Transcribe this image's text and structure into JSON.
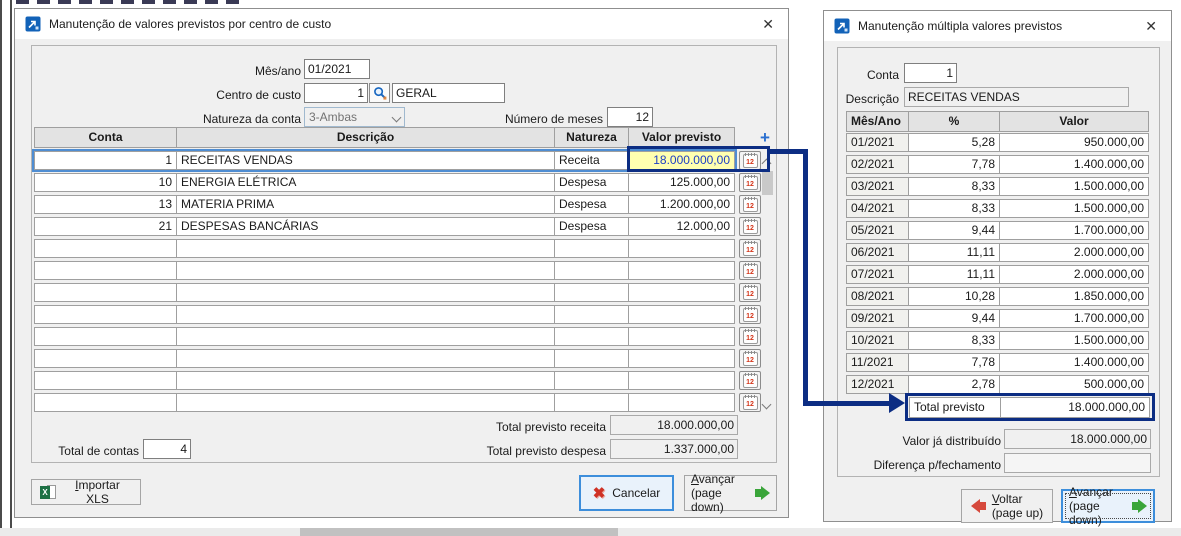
{
  "icons": {
    "close": "✕",
    "plus": "+",
    "cancel_x": "✖",
    "calendar_day": "12",
    "excel_letter": "X"
  },
  "colors": {
    "accent_navy": "#0c2d83",
    "selection_blue": "#4f8dd2",
    "highlight_yellow": "#ffffb0",
    "highlight_text_blue": "#1d3fc4",
    "focus_blue": "#3d8edb",
    "green_arrow": "#3aa53a",
    "red_arrow": "#d6493c",
    "cancel_red": "#cf3226",
    "excel_green": "#1e7145",
    "icon_blue": "#1565c0"
  },
  "left_window": {
    "title": "Manutenção de valores previstos por centro de custo",
    "form": {
      "mes_ano": {
        "label": "Mês/ano",
        "value": "01/2021"
      },
      "centro_custo": {
        "label": "Centro de custo",
        "code": "1",
        "name": "GERAL"
      },
      "natureza": {
        "label": "Natureza da conta",
        "value": "3-Ambas"
      },
      "numero_meses": {
        "label": "Número de meses",
        "value": "12"
      }
    },
    "table": {
      "headers": [
        "Conta",
        "Descrição",
        "Natureza",
        "Valor previsto"
      ],
      "selected_row": 0,
      "rows": [
        {
          "conta": "1",
          "descricao": "RECEITAS VENDAS",
          "natureza": "Receita",
          "valor": "18.000.000,00"
        },
        {
          "conta": "10",
          "descricao": "ENERGIA ELÉTRICA",
          "natureza": "Despesa",
          "valor": "125.000,00"
        },
        {
          "conta": "13",
          "descricao": "MATERIA PRIMA",
          "natureza": "Despesa",
          "valor": "1.200.000,00"
        },
        {
          "conta": "21",
          "descricao": "DESPESAS BANCÁRIAS",
          "natureza": "Despesa",
          "valor": "12.000,00"
        },
        {
          "conta": "",
          "descricao": "",
          "natureza": "",
          "valor": ""
        },
        {
          "conta": "",
          "descricao": "",
          "natureza": "",
          "valor": ""
        },
        {
          "conta": "",
          "descricao": "",
          "natureza": "",
          "valor": ""
        },
        {
          "conta": "",
          "descricao": "",
          "natureza": "",
          "valor": ""
        },
        {
          "conta": "",
          "descricao": "",
          "natureza": "",
          "valor": ""
        },
        {
          "conta": "",
          "descricao": "",
          "natureza": "",
          "valor": ""
        },
        {
          "conta": "",
          "descricao": "",
          "natureza": "",
          "valor": ""
        },
        {
          "conta": "",
          "descricao": "",
          "natureza": "",
          "valor": ""
        }
      ]
    },
    "totals": {
      "receita": {
        "label": "Total previsto receita",
        "value": "18.000.000,00"
      },
      "despesa": {
        "label": "Total previsto despesa",
        "value": "1.337.000,00"
      },
      "contas": {
        "label": "Total de contas",
        "value": "4"
      }
    },
    "buttons": {
      "importar": "Importar XLS",
      "cancelar": "Cancelar",
      "avancar": {
        "line1": "Avançar",
        "line2": "(page down)"
      }
    }
  },
  "right_window": {
    "title": "Manutenção múltipla valores previstos",
    "form": {
      "conta": {
        "label": "Conta",
        "value": "1"
      },
      "descricao": {
        "label": "Descrição",
        "value": "RECEITAS VENDAS"
      }
    },
    "table": {
      "headers": [
        "Mês/Ano",
        "%",
        "Valor"
      ],
      "rows": [
        {
          "mes": "01/2021",
          "pct": "5,28",
          "valor": "950.000,00"
        },
        {
          "mes": "02/2021",
          "pct": "7,78",
          "valor": "1.400.000,00"
        },
        {
          "mes": "03/2021",
          "pct": "8,33",
          "valor": "1.500.000,00"
        },
        {
          "mes": "04/2021",
          "pct": "8,33",
          "valor": "1.500.000,00"
        },
        {
          "mes": "05/2021",
          "pct": "9,44",
          "valor": "1.700.000,00"
        },
        {
          "mes": "06/2021",
          "pct": "11,11",
          "valor": "2.000.000,00"
        },
        {
          "mes": "07/2021",
          "pct": "11,11",
          "valor": "2.000.000,00"
        },
        {
          "mes": "08/2021",
          "pct": "10,28",
          "valor": "1.850.000,00"
        },
        {
          "mes": "09/2021",
          "pct": "9,44",
          "valor": "1.700.000,00"
        },
        {
          "mes": "10/2021",
          "pct": "8,33",
          "valor": "1.500.000,00"
        },
        {
          "mes": "11/2021",
          "pct": "7,78",
          "valor": "1.400.000,00"
        },
        {
          "mes": "12/2021",
          "pct": "2,78",
          "valor": "500.000,00"
        }
      ]
    },
    "total_row": {
      "label": "Total previsto",
      "value": "18.000.000,00"
    },
    "summary": {
      "distribuido": {
        "label": "Valor já distribuído",
        "value": "18.000.000,00"
      },
      "diferenca": {
        "label": "Diferença p/fechamento",
        "value": ""
      }
    },
    "buttons": {
      "voltar": {
        "line1": "Voltar",
        "line2": "(page up)"
      },
      "avancar": {
        "line1": "Avançar",
        "line2": "(page down)"
      }
    }
  }
}
